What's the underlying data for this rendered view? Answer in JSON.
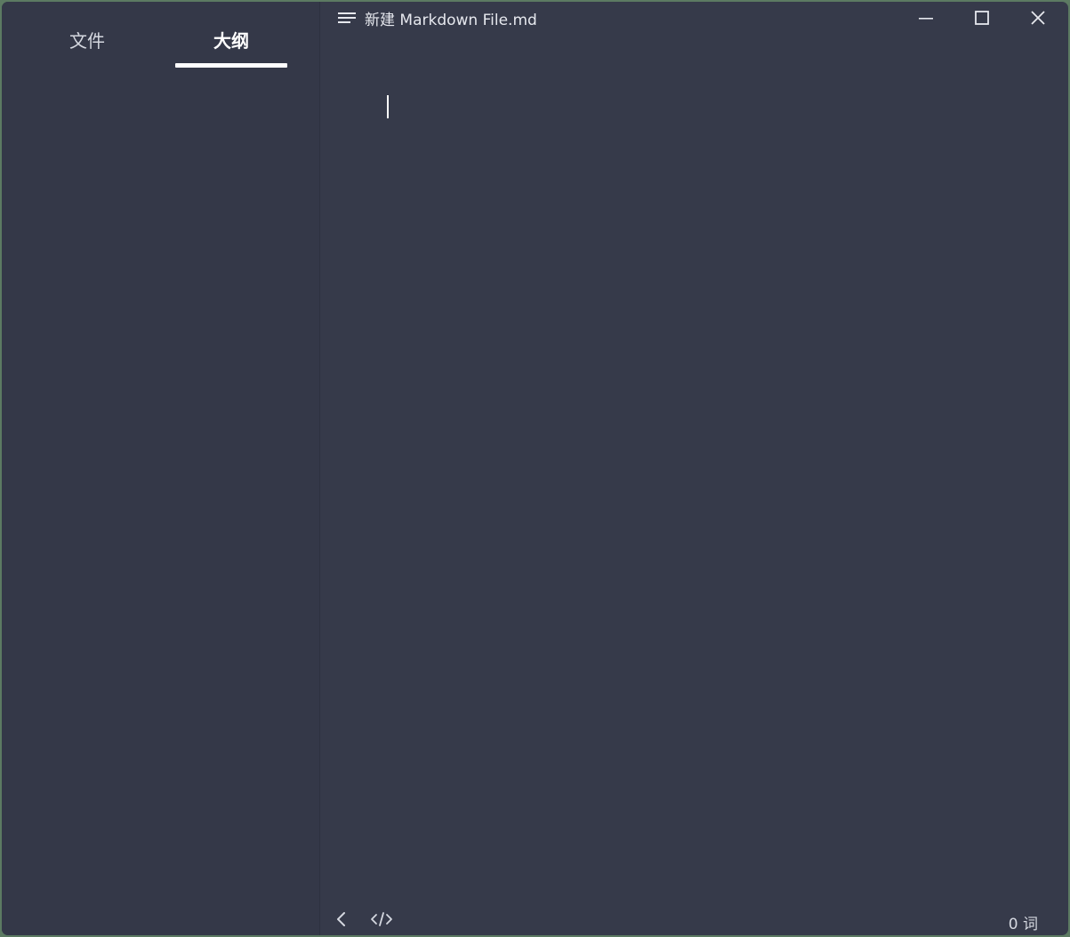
{
  "sidebar": {
    "tabs": [
      {
        "label": "文件",
        "active": false
      },
      {
        "label": "大纲",
        "active": true
      }
    ]
  },
  "titlebar": {
    "menu_icon": "hamburger-menu-icon",
    "title": "新建 Markdown File.md",
    "controls": [
      "minimize-icon",
      "maximize-icon",
      "close-icon"
    ]
  },
  "editor": {
    "content": ""
  },
  "statusbar": {
    "back_icon": "chevron-left-icon",
    "source_icon": "code-icon",
    "word_count": "0 词"
  },
  "colors": {
    "background": "#363a4a",
    "sidebar": "#343848",
    "text": "#d5d8e0",
    "active": "#ffffff"
  }
}
